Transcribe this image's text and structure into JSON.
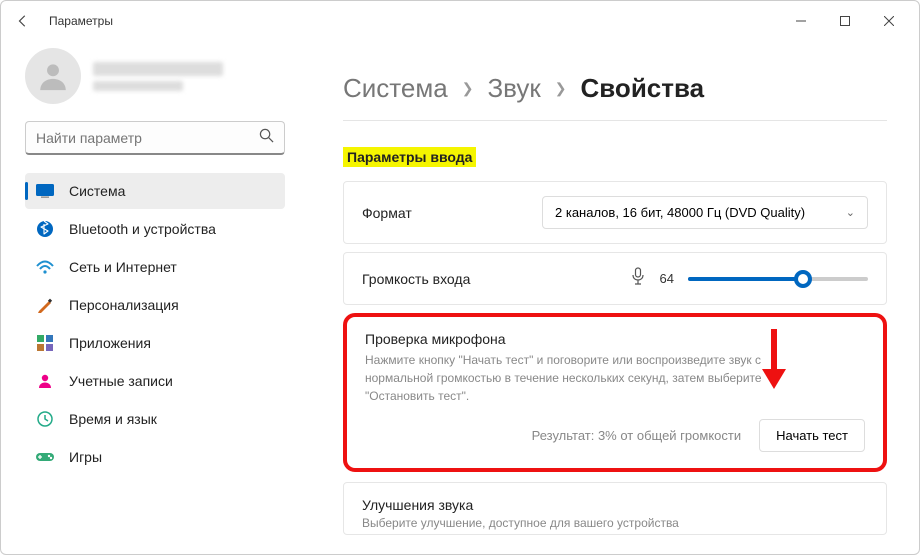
{
  "window": {
    "title": "Параметры"
  },
  "search": {
    "placeholder": "Найти параметр"
  },
  "nav": {
    "items": [
      {
        "label": "Система",
        "icon": "system"
      },
      {
        "label": "Bluetooth и устройства",
        "icon": "bluetooth"
      },
      {
        "label": "Сеть и Интернет",
        "icon": "network"
      },
      {
        "label": "Персонализация",
        "icon": "personalization"
      },
      {
        "label": "Приложения",
        "icon": "apps"
      },
      {
        "label": "Учетные записи",
        "icon": "accounts"
      },
      {
        "label": "Время и язык",
        "icon": "time"
      },
      {
        "label": "Игры",
        "icon": "games"
      }
    ],
    "active_index": 0
  },
  "breadcrumb": {
    "items": [
      "Система",
      "Звук",
      "Свойства"
    ]
  },
  "section": {
    "heading": "Параметры ввода"
  },
  "format": {
    "label": "Формат",
    "value": "2 каналов, 16 бит, 48000 Гц (DVD Quality)"
  },
  "volume": {
    "label": "Громкость входа",
    "value": 64,
    "value_text": "64"
  },
  "mictest": {
    "title": "Проверка микрофона",
    "description": "Нажмите кнопку \"Начать тест\" и поговорите или воспроизведите звук с нормальной громкостью в течение нескольких секунд, затем выберите \"Остановить тест\".",
    "result": "Результат: 3% от общей громкости",
    "button": "Начать тест"
  },
  "enhancements": {
    "title": "Улучшения звука",
    "description": "Выберите улучшение, доступное для вашего устройства"
  }
}
